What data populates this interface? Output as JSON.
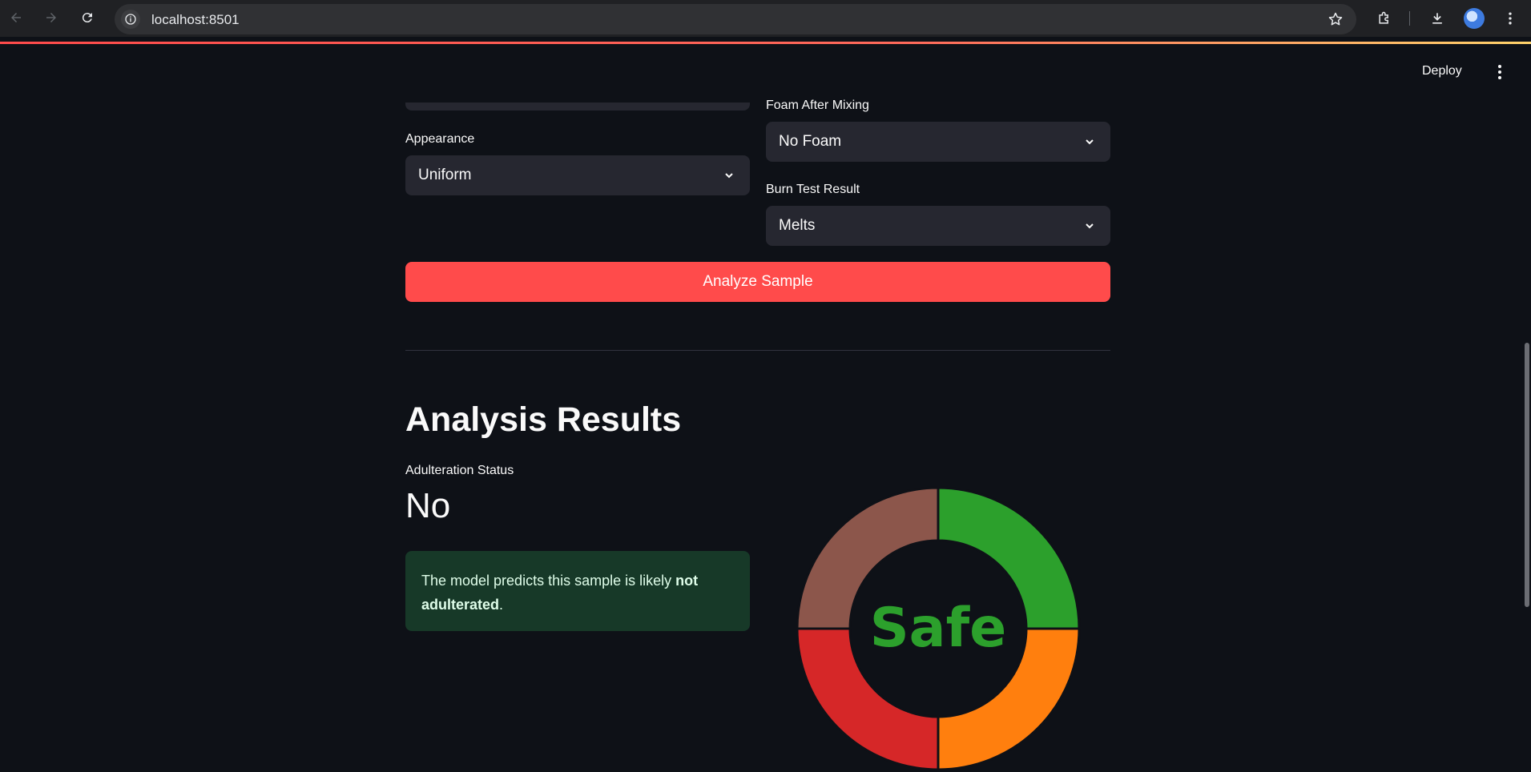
{
  "browser": {
    "url": "localhost:8501",
    "icons": [
      "back-icon",
      "forward-icon",
      "reload-icon",
      "site-info-icon",
      "bookmark-star-icon",
      "extensions-icon",
      "download-icon",
      "profile-avatar",
      "browser-menu-icon"
    ]
  },
  "header": {
    "deploy_label": "Deploy"
  },
  "form": {
    "appearance": {
      "label": "Appearance",
      "value": "Uniform"
    },
    "foam": {
      "label": "Foam After Mixing",
      "value": "No Foam"
    },
    "burn": {
      "label": "Burn Test Result",
      "value": "Melts"
    },
    "analyze_label": "Analyze Sample"
  },
  "results": {
    "heading": "Analysis Results",
    "metric_label": "Adulteration Status",
    "metric_value": "No",
    "message_prefix": "The model predicts this sample is likely ",
    "message_bold": "not adulterated",
    "message_suffix": "."
  },
  "gauge": {
    "center_text": "Safe",
    "center_color": "#2ca02c",
    "segments": [
      {
        "color": "#2ca02c"
      },
      {
        "color": "#ff7f0e"
      },
      {
        "color": "#d62728"
      },
      {
        "color": "#8c564b"
      }
    ]
  },
  "colors": {
    "background": "#0e1117",
    "primary": "#ff4b4b",
    "input_bg": "#262730",
    "success_bg": "#173928"
  }
}
